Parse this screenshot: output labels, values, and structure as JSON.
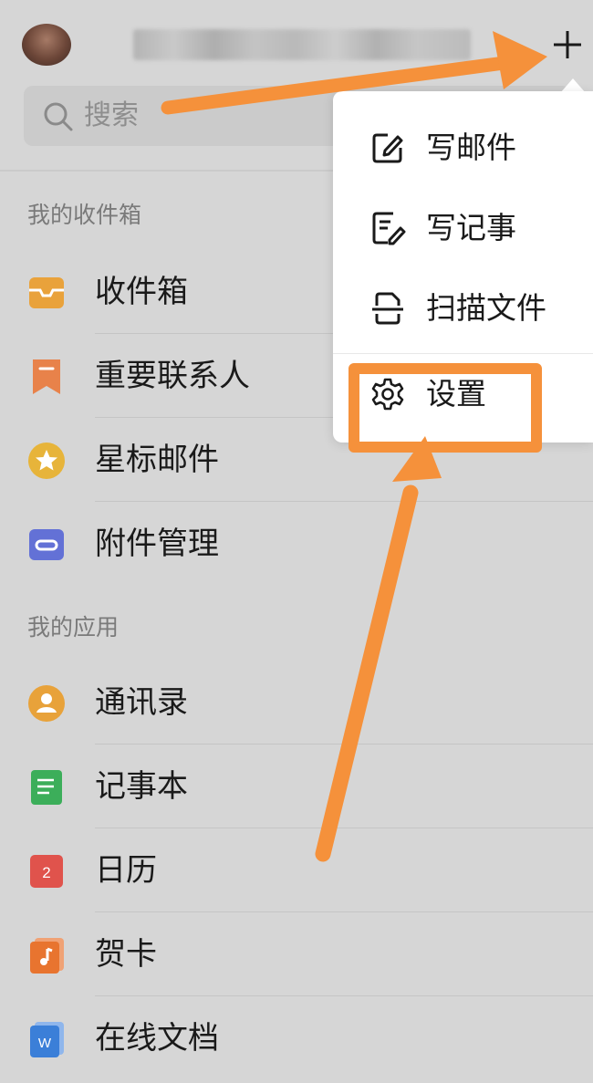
{
  "header": {
    "avatar_icon": "user-avatar",
    "plus_icon": "plus-icon"
  },
  "search": {
    "placeholder": "搜索",
    "icon": "search-icon"
  },
  "sections": [
    {
      "title": "我的收件箱",
      "items": [
        {
          "label": "收件箱",
          "icon": "inbox-icon",
          "color": "#e9a23b"
        },
        {
          "label": "重要联系人",
          "icon": "bookmark-icon",
          "color": "#e8824a"
        },
        {
          "label": "星标邮件",
          "icon": "star-icon",
          "color": "#e7b43a"
        },
        {
          "label": "附件管理",
          "icon": "attachment-icon",
          "color": "#6371d6"
        }
      ]
    },
    {
      "title": "我的应用",
      "items": [
        {
          "label": "通讯录",
          "icon": "contacts-icon",
          "color": "#e8a23a"
        },
        {
          "label": "记事本",
          "icon": "notebook-icon",
          "color": "#3cae5a"
        },
        {
          "label": "日历",
          "icon": "calendar-icon",
          "color": "#e0534c",
          "badge": "2"
        },
        {
          "label": "贺卡",
          "icon": "greeting-card-icon",
          "color": "#e8742f"
        },
        {
          "label": "在线文档",
          "icon": "online-doc-icon",
          "color": "#3b7fd8",
          "badge": "W"
        }
      ]
    }
  ],
  "popup_menu": {
    "items": [
      {
        "label": "写邮件",
        "icon": "compose-icon"
      },
      {
        "label": "写记事",
        "icon": "note-edit-icon"
      },
      {
        "label": "扫描文件",
        "icon": "scan-icon"
      },
      {
        "label": "设置",
        "icon": "gear-icon"
      }
    ]
  },
  "annotation": {
    "color": "#f5913b"
  }
}
